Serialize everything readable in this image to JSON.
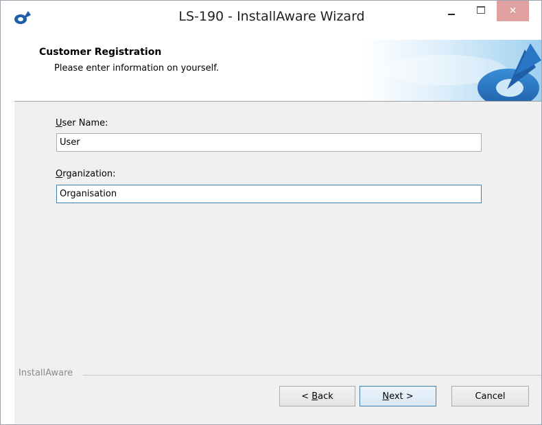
{
  "window": {
    "title": "LS-190 - InstallAware Wizard",
    "close_glyph": "✕",
    "accent_color": "#3c7fb1",
    "close_color": "#e0a0a0"
  },
  "header": {
    "title": "Customer Registration",
    "subtitle": "Please enter information on yourself."
  },
  "form": {
    "user_name": {
      "label_underlined": "U",
      "label_rest": "ser Name:",
      "value": "User"
    },
    "organization": {
      "label_underlined": "O",
      "label_rest": "rganization:",
      "value": "Organisation"
    }
  },
  "footer": {
    "group_label": "InstallAware",
    "back": {
      "prefix": "< ",
      "underlined": "B",
      "rest": "ack"
    },
    "next": {
      "underlined": "N",
      "rest": "ext >"
    },
    "cancel": "Cancel"
  },
  "icons": [
    "installaware-app-icon",
    "minimize-icon",
    "maximize-icon",
    "close-icon",
    "installaware-logo-graphic"
  ]
}
